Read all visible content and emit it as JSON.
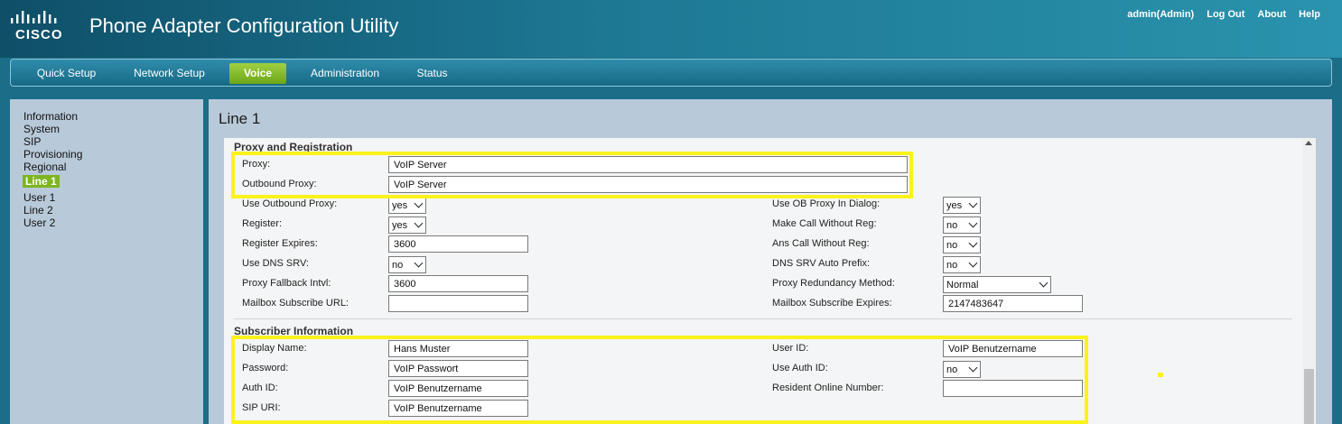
{
  "app": {
    "brand": "CISCO",
    "title": "Phone Adapter Configuration Utility"
  },
  "topnav": {
    "user": "admin(Admin)",
    "logout": "Log Out",
    "about": "About",
    "help": "Help"
  },
  "tabs": [
    "Quick Setup",
    "Network Setup",
    "Voice",
    "Administration",
    "Status"
  ],
  "active_tab": "Voice",
  "sidebar": [
    "Information",
    "System",
    "SIP",
    "Provisioning",
    "Regional",
    "Line 1",
    "User 1",
    "Line 2",
    "User 2"
  ],
  "active_sidebar": "Line 1",
  "page_title": "Line 1",
  "proxy": {
    "heading": "Proxy and Registration",
    "proxy_label": "Proxy:",
    "proxy_value": "VoIP Server",
    "outbound_proxy_label": "Outbound Proxy:",
    "outbound_proxy_value": "VoIP Server",
    "use_outbound_proxy_label": "Use Outbound Proxy:",
    "use_outbound_proxy_value": "yes",
    "register_label": "Register:",
    "register_value": "yes",
    "register_expires_label": "Register Expires:",
    "register_expires_value": "3600",
    "use_dns_srv_label": "Use DNS SRV:",
    "use_dns_srv_value": "no",
    "proxy_fallback_label": "Proxy Fallback Intvl:",
    "proxy_fallback_value": "3600",
    "mailbox_url_label": "Mailbox Subscribe URL:",
    "mailbox_url_value": "",
    "use_ob_proxy_dialog_label": "Use OB Proxy In Dialog:",
    "use_ob_proxy_dialog_value": "yes",
    "make_call_without_reg_label": "Make Call Without Reg:",
    "make_call_without_reg_value": "no",
    "ans_call_without_reg_label": "Ans Call Without Reg:",
    "ans_call_without_reg_value": "no",
    "dns_srv_auto_prefix_label": "DNS SRV Auto Prefix:",
    "dns_srv_auto_prefix_value": "no",
    "proxy_redundancy_label": "Proxy Redundancy Method:",
    "proxy_redundancy_value": "Normal",
    "mailbox_expires_label": "Mailbox Subscribe Expires:",
    "mailbox_expires_value": "2147483647"
  },
  "subscriber": {
    "heading": "Subscriber Information",
    "display_name_label": "Display Name:",
    "display_name_value": "Hans Muster",
    "password_label": "Password:",
    "password_value": "VoIP Passwort",
    "auth_id_label": "Auth ID:",
    "auth_id_value": "VoIP Benutzername",
    "sip_uri_label": "SIP URI:",
    "sip_uri_value": "VoIP Benutzername",
    "user_id_label": "User ID:",
    "user_id_value": "VoIP Benutzername",
    "use_auth_id_label": "Use Auth ID:",
    "use_auth_id_value": "no",
    "resident_online_label": "Resident Online Number:",
    "resident_online_value": ""
  },
  "colors": {
    "highlight": "#fbf21d",
    "active_green": "#7db520",
    "header_blue": "#1b6d88"
  }
}
